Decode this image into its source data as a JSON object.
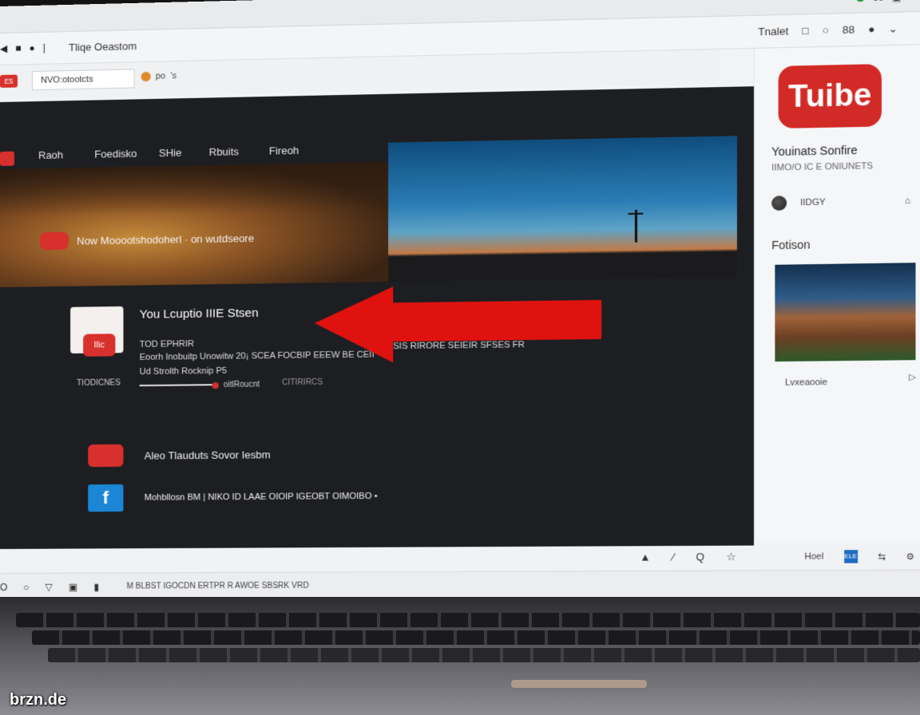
{
  "os_bar": {
    "icons": [
      "●",
      "88",
      "▣"
    ]
  },
  "browser": {
    "title": "Tliqe Oeastom",
    "nav_icons": [
      "◀",
      "■",
      "●",
      "|"
    ],
    "tools": [
      "Tnalet",
      "□",
      "○",
      "88",
      "●",
      "⌄"
    ]
  },
  "address": {
    "badge": "E5",
    "field_value": "NVO:otootcts",
    "extra_label": "po",
    "extra_tail": "’s"
  },
  "topnav": {
    "items": [
      "Raoh",
      "Foedisko",
      "SHie",
      "Rbuits",
      "Fireoh"
    ]
  },
  "banner": {
    "caption": "Now Mooootshodoherl · on wutdseore"
  },
  "content": {
    "thumb_badge": "Ilic",
    "thumb_label": "TIODICNES",
    "title": "You Lcuptio IIIE Stsen",
    "meta": "TOD EPHRIR",
    "desc_line1": "Eoorh Inobuitp Unowitw 20¡ SCEA FOCBIP EEEW BE CEII",
    "desc_line1b": "SIS RIRORE SEIEIR SFSES FR",
    "desc_line2": "Ud Strolth Rocknip P5",
    "link": "oitlRoucnt",
    "sublink": "CITIRIRCS"
  },
  "share": {
    "youtube_label": "Aleo Tlauduts Sovor Iesbm",
    "facebook_label": "Mohbllosn BM | NIKO ID LAAE OIOIP IGEOBT OIMOIBO •",
    "facebook_glyph": "f"
  },
  "sidebar": {
    "logo_text": "Tuibe",
    "title": "Youinats Sonfire",
    "subtitle": "IIMO/O IC E ONIUNETS",
    "row_label": "IIDGY",
    "row_icon": "⌂",
    "section": "Fotison",
    "caption": "Lvxeaooie",
    "caption_icon": "▷"
  },
  "player": {
    "icons": [
      "▲",
      "∕",
      "Q",
      "☆"
    ],
    "right_label": "Hoel",
    "blue_badge": "ELE",
    "icons_right": [
      "⇆",
      "⚙"
    ]
  },
  "status": {
    "icons": [
      "O",
      "○",
      "▽",
      "▣",
      "▮"
    ],
    "text": "M BLBST IGOCDN ERTPR R AWOE SBSRK VRD"
  },
  "watermark": "brzn.de",
  "colors": {
    "youtube_red": "#d8302c",
    "facebook_blue": "#1b86d6",
    "dark_pane": "#1d1e21",
    "arrow": "#e01210"
  }
}
